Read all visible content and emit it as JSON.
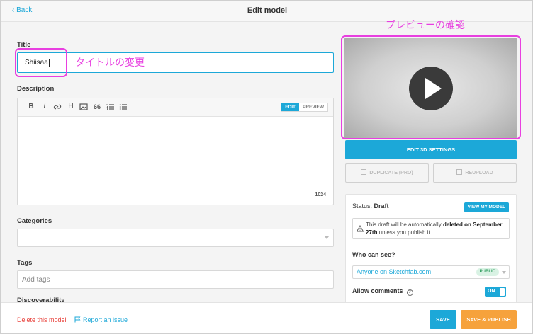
{
  "header": {
    "back_label": "‹ Back",
    "title": "Edit model"
  },
  "form": {
    "title_label": "Title",
    "title_value": "Shiisaa",
    "description_label": "Description",
    "editor": {
      "mode_edit": "EDIT",
      "mode_preview": "PREVIEW",
      "char_count": "1024",
      "toolbar_icons": [
        "bold-icon",
        "italic-icon",
        "link-icon",
        "heading-icon",
        "image-icon",
        "quote-icon",
        "ordered-list-icon",
        "bullet-list-icon"
      ]
    },
    "categories_label": "Categories",
    "tags_label": "Tags",
    "tags_placeholder": "Add tags",
    "discoverability_label": "Discoverability"
  },
  "annotations": {
    "title_note": "タイトルの変更",
    "preview_note": "プレビューの確認",
    "color": "#e83fe0"
  },
  "sidebar": {
    "edit_3d_label": "EDIT 3D SETTINGS",
    "duplicate_label": "DUPLICATE (PRO)",
    "reupload_label": "REUPLOAD",
    "status_prefix": "Status:",
    "status_value": "Draft",
    "view_model_label": "VIEW MY MODEL",
    "notice_part1": "This draft will be automatically ",
    "notice_bold1": "deleted on September 27th",
    "notice_part2": " unless you publish it.",
    "who_label": "Who can see?",
    "visibility_value": "Anyone on Sketchfab.com",
    "visibility_badge": "PUBLIC",
    "comments_label": "Allow comments",
    "comments_toggle": "ON"
  },
  "footer": {
    "delete_label": "Delete this model",
    "report_label": "Report an issue",
    "save_label": "SAVE",
    "publish_label": "SAVE & PUBLISH"
  },
  "colors": {
    "accent": "#1ca8d8",
    "publish": "#f6a23c",
    "danger": "#e8403a"
  }
}
